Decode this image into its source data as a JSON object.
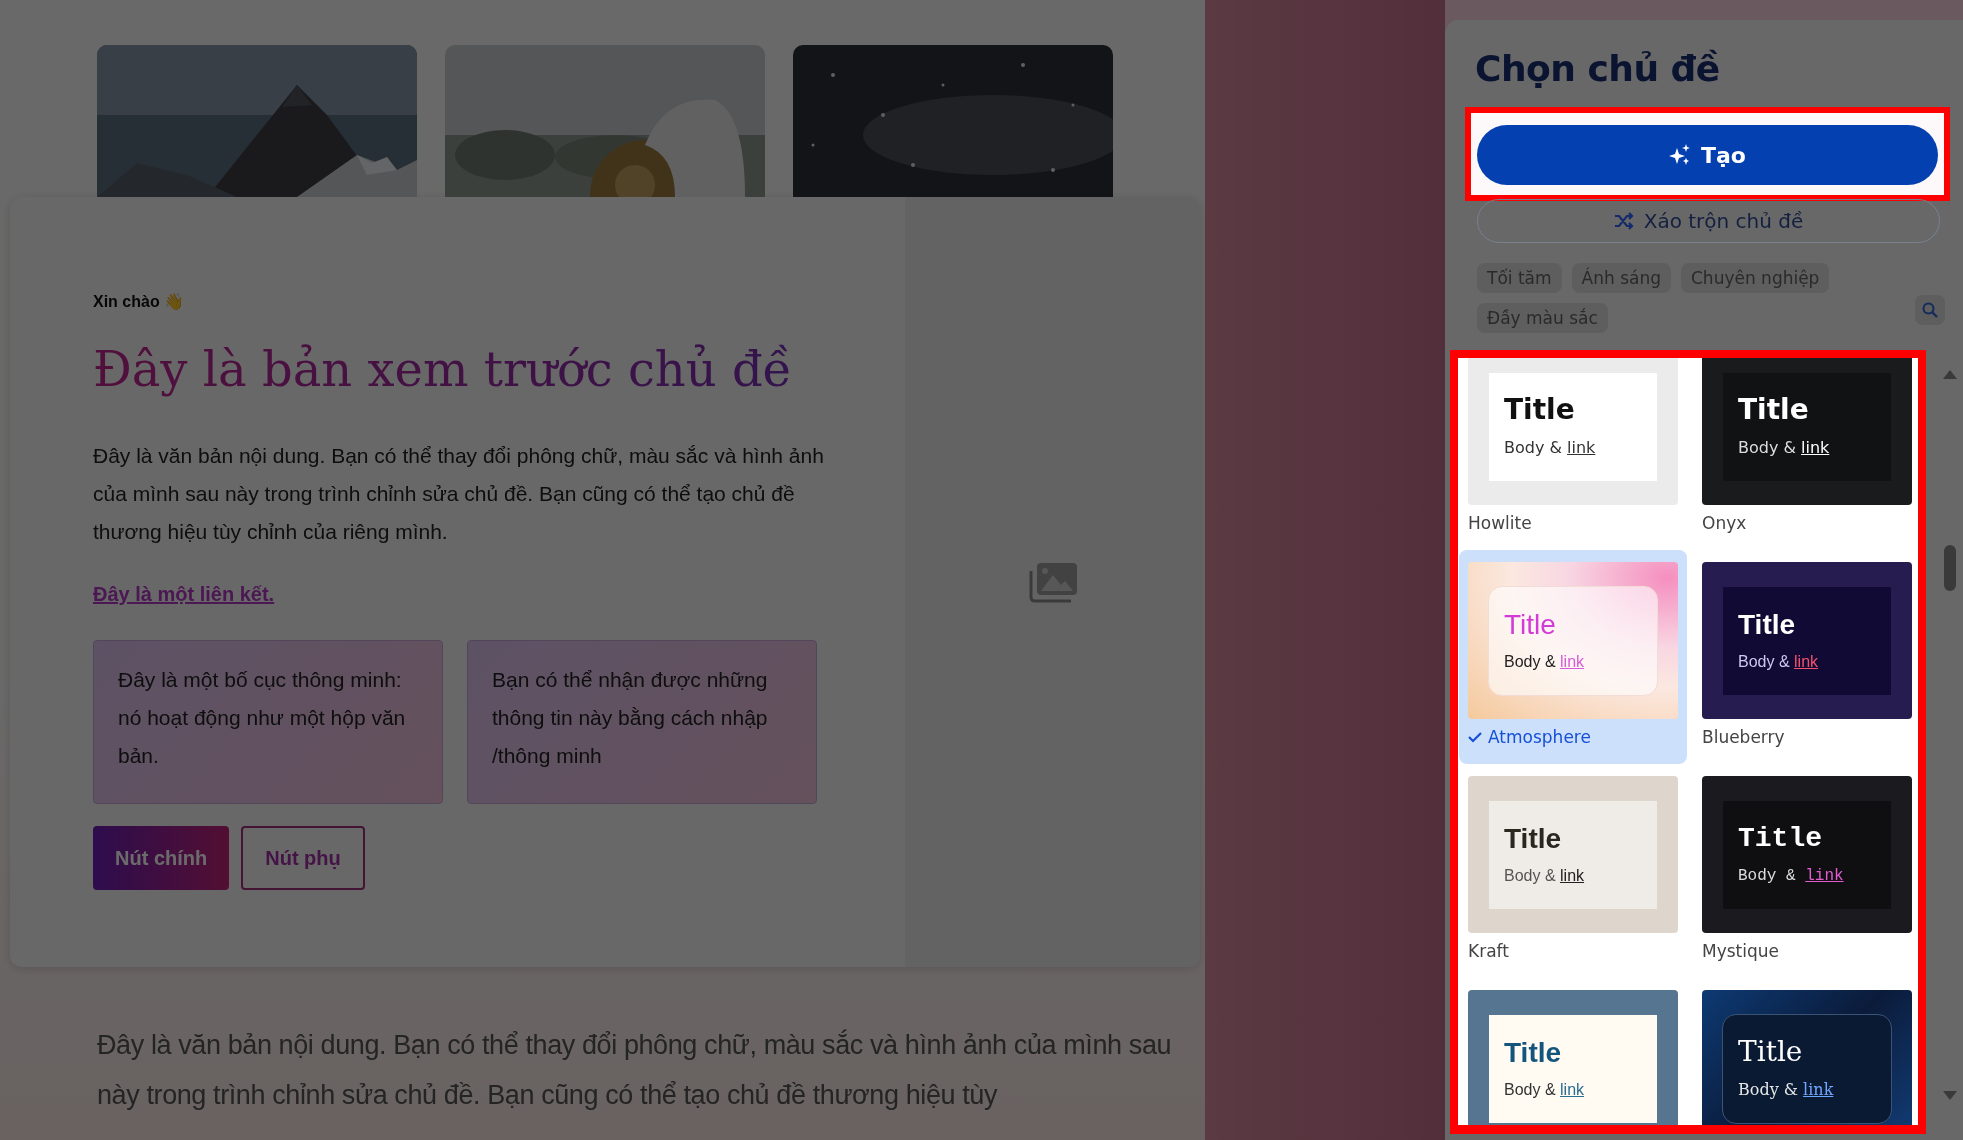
{
  "preview": {
    "photos": [
      {
        "kind": "picture"
      },
      {
        "kind": "picture"
      },
      {
        "kind": "picture"
      }
    ],
    "greeting": "Xin chào 👋",
    "title": "Đây là bản xem trước chủ đề",
    "body": "Đây là văn bản nội dung. Bạn có thể thay đổi phông chữ, màu sắc và hình ảnh của mình sau này trong trình chỉnh sửa chủ đề. Bạn cũng có thể tạo chủ đề thương hiệu tùy chỉnh của riêng mình.",
    "link": "Đây là một liên kết.",
    "smart_boxes": [
      "Đây là một bố cục thông minh: nó hoạt động như một hộp văn bản.",
      "Bạn có thể nhận được những thông tin này bằng cách nhập /thông minh"
    ],
    "buttons": [
      {
        "label": "Nút chính",
        "kind": "primary"
      },
      {
        "label": "Nút phụ",
        "kind": "secondary"
      }
    ]
  },
  "page_body": "Đây là văn bản nội dung. Bạn có thể thay đổi phông chữ, màu sắc và hình ảnh của mình sau này trong trình chỉnh sửa chủ đề. Bạn cũng có thể tạo chủ đề thương hiệu tùy",
  "panel": {
    "title": "Chọn chủ đề",
    "create_button": "Tạo",
    "shuffle_button": "Xáo trộn chủ đề",
    "filters": [
      "Tối tăm",
      "Ánh sáng",
      "Chuyên nghiệp",
      "Đầy màu sắc"
    ],
    "themes": [
      {
        "name": "Howlite",
        "selected": false,
        "title": "Title",
        "body": "Body &",
        "link": "link"
      },
      {
        "name": "Onyx",
        "selected": false,
        "title": "Title",
        "body": "Body &",
        "link": "link"
      },
      {
        "name": "Atmosphere",
        "selected": true,
        "title": "Title",
        "body": "Body &",
        "link": "link"
      },
      {
        "name": "Blueberry",
        "selected": false,
        "title": "Title",
        "body": "Body &",
        "link": "link"
      },
      {
        "name": "Kraft",
        "selected": false,
        "title": "Title",
        "body": "Body &",
        "link": "link"
      },
      {
        "name": "Mystique",
        "selected": false,
        "title": "Title",
        "body": "Body &",
        "link": "link"
      },
      {
        "selected": false,
        "title": "Title",
        "body": "Body &",
        "link": "link"
      },
      {
        "selected": false,
        "title": "Title",
        "body": "Body &",
        "link": "link"
      }
    ]
  }
}
